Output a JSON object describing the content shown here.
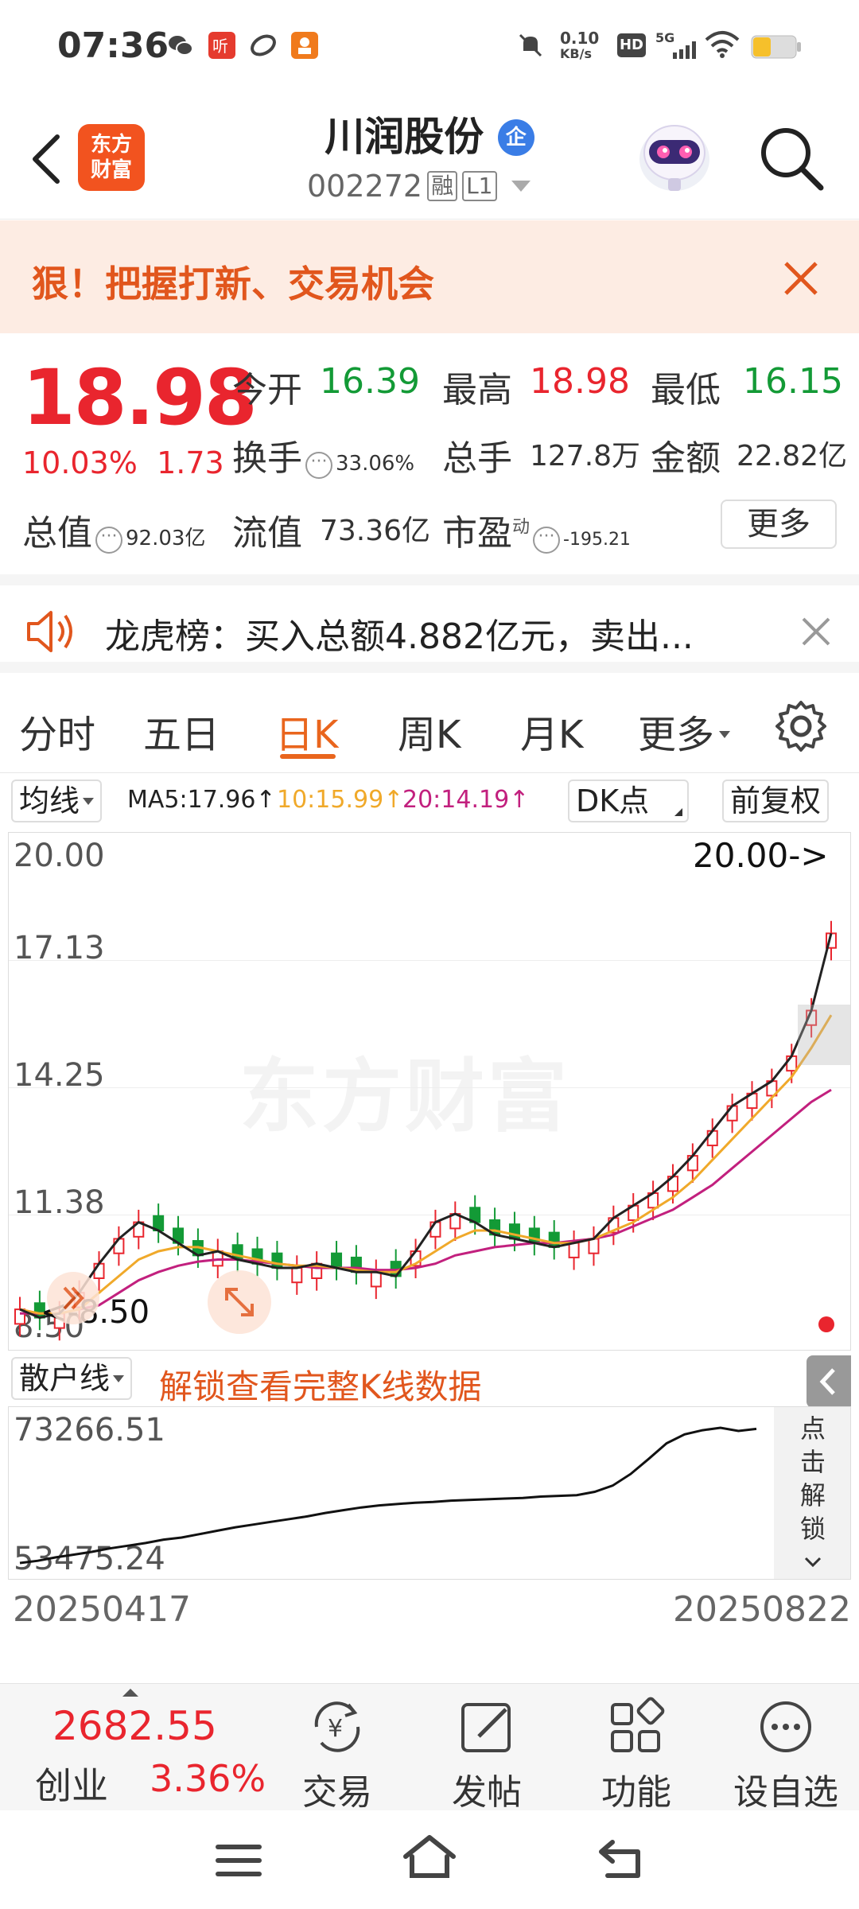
{
  "status_bar": {
    "time": "07:36",
    "net_speed_top": "0.10",
    "net_speed_bottom": "KB/s",
    "network": "5G",
    "hd": "HD"
  },
  "header": {
    "logo_line1": "东方",
    "logo_line2": "财富",
    "stock_name": "川润股份",
    "badge": "企",
    "stock_code": "002272",
    "tag_margin": "融",
    "tag_level": "L1"
  },
  "promo": {
    "text": "狠！把握打新、交易机会"
  },
  "quote": {
    "price": "18.98",
    "change_pct": "10.03%",
    "change_amt": "1.73",
    "open_label": "今开",
    "open_value": "16.39",
    "high_label": "最高",
    "high_value": "18.98",
    "low_label": "最低",
    "low_value": "16.15",
    "turnover_label": "换手",
    "turnover_value": "33.06%",
    "volume_label": "总手",
    "volume_value": "127.8万",
    "amount_label": "金额",
    "amount_value": "22.82亿",
    "mktcap_label": "总值",
    "mktcap_value": "92.03亿",
    "float_label": "流值",
    "float_value": "73.36亿",
    "pe_label": "市盈",
    "pe_superscript": "动",
    "pe_value": "-195.21",
    "more_label": "更多"
  },
  "ticker": {
    "text": "龙虎榜：买入总额4.882亿元，卖出..."
  },
  "tabs": {
    "items": [
      "分时",
      "五日",
      "日K",
      "周K",
      "月K",
      "更多"
    ],
    "active": "日K"
  },
  "indicators": {
    "avg_label": "均线",
    "ma5": "MA5:17.96",
    "ma10": "10:15.99",
    "ma20": "20:14.19",
    "dk_label": "DK点",
    "adjust_label": "前复权",
    "colors": {
      "ma5": "#222222",
      "ma10": "#f0a92a",
      "ma20": "#c2207e"
    }
  },
  "chart": {
    "y_labels": [
      "20.00",
      "17.13",
      "14.25",
      "11.38",
      "8.50"
    ],
    "high_marker": "20.00->",
    "low_marker": "<-8.50",
    "watermark": "东方财富"
  },
  "sub_chart": {
    "indicator_label": "散户线",
    "unlock_text": "解锁查看完整K线数据",
    "y_top": "73266.51",
    "y_bottom": "53475.24",
    "side_unlock": [
      "点",
      "击",
      "解",
      "锁"
    ],
    "date_start": "20250417",
    "date_end": "20250822"
  },
  "bottom_bar": {
    "index_value": "2682.55",
    "index_name": "创业",
    "index_change": "3.36%",
    "items": [
      "交易",
      "发帖",
      "功能",
      "设自选"
    ]
  },
  "chart_data": {
    "type": "candlestick",
    "ylim": [
      8.5,
      20.0
    ],
    "x_range": [
      "20250417",
      "20250822"
    ],
    "series": [
      {
        "name": "MA5",
        "values": [
          8.9,
          8.7,
          8.8,
          9.3,
          10.0,
          10.6,
          11.0,
          10.8,
          10.5,
          10.2,
          10.3,
          10.1,
          10.0,
          9.9,
          9.9,
          10.0,
          9.9,
          9.8,
          9.8,
          9.7,
          10.3,
          11.0,
          11.2,
          11.0,
          10.7,
          10.6,
          10.5,
          10.4,
          10.5,
          10.6,
          11.1,
          11.4,
          11.7,
          12.1,
          12.6,
          13.2,
          13.8,
          14.1,
          14.4,
          15.0,
          16.1,
          17.96
        ]
      },
      {
        "name": "10",
        "values": [
          8.9,
          8.8,
          8.8,
          8.9,
          9.3,
          9.7,
          10.1,
          10.3,
          10.4,
          10.4,
          10.3,
          10.2,
          10.1,
          10.0,
          9.95,
          9.95,
          9.9,
          9.85,
          9.8,
          9.8,
          10.0,
          10.3,
          10.6,
          10.8,
          10.8,
          10.7,
          10.6,
          10.5,
          10.5,
          10.6,
          10.8,
          11.0,
          11.3,
          11.6,
          12.0,
          12.5,
          13.0,
          13.5,
          14.0,
          14.5,
          15.2,
          15.99
        ]
      },
      {
        "name": "20",
        "values": [
          8.8,
          8.8,
          8.8,
          8.9,
          9.0,
          9.3,
          9.6,
          9.8,
          9.95,
          10.05,
          10.1,
          10.1,
          10.05,
          10.0,
          9.95,
          9.9,
          9.9,
          9.9,
          9.85,
          9.85,
          9.9,
          10.0,
          10.2,
          10.3,
          10.4,
          10.45,
          10.5,
          10.5,
          10.55,
          10.6,
          10.7,
          10.9,
          11.1,
          11.3,
          11.6,
          11.9,
          12.3,
          12.7,
          13.1,
          13.5,
          13.9,
          14.19
        ]
      }
    ],
    "sub_series": {
      "name": "散户线",
      "ylim": [
        53475.24,
        73266.51
      ],
      "values": [
        53475.24,
        53800,
        54300,
        54700,
        55100,
        55600,
        56000,
        56400,
        56900,
        57200,
        57700,
        58200,
        58700,
        59100,
        59500,
        59900,
        60300,
        60800,
        61200,
        61600,
        61900,
        62100,
        62300,
        62400,
        62600,
        62700,
        62800,
        62900,
        63000,
        63200,
        63300,
        63400,
        63900,
        64800,
        66500,
        68700,
        71000,
        72300,
        72900,
        73266.51,
        72800,
        73100
      ]
    }
  }
}
